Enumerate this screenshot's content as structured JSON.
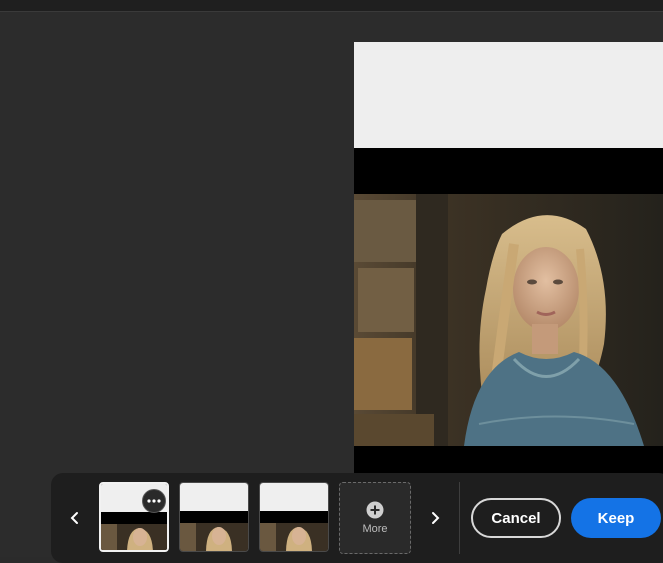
{
  "variations": {
    "items": [
      {
        "name": "variation-1",
        "selected": true
      },
      {
        "name": "variation-2",
        "selected": false
      },
      {
        "name": "variation-3",
        "selected": false
      }
    ],
    "more_label": "More"
  },
  "actions": {
    "cancel_label": "Cancel",
    "keep_label": "Keep"
  },
  "icons": {
    "prev": "chevron-left-icon",
    "next": "chevron-right-icon",
    "more": "plus-circle-icon",
    "options": "more-options-icon"
  },
  "colors": {
    "accent": "#1473e6",
    "background": "#2c2c2c",
    "toolbar": "#1e1e1e"
  }
}
